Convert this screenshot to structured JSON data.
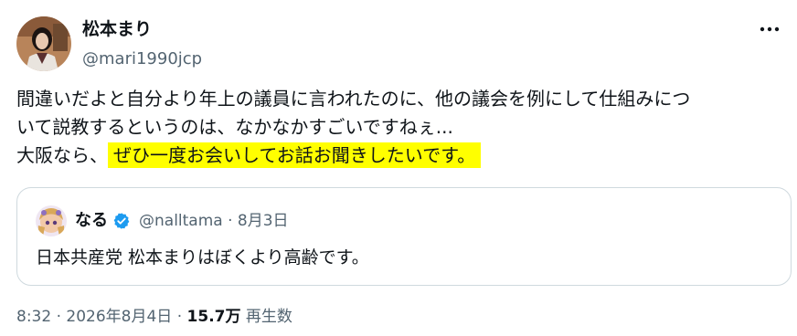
{
  "colors": {
    "highlight": "#ffff00",
    "verified_badge": "#1d9bf0",
    "secondary_text": "#536471",
    "border": "#cfd9de"
  },
  "author": {
    "display_name": "松本まり",
    "handle": "@mari1990jcp",
    "avatar_icon": "profile-photo"
  },
  "menu": {
    "icon": "more-horizontal-icon"
  },
  "tweet": {
    "line1": "間違いだよと自分より年上の議員に言われたのに、他の議会を例にして仕組みにつ",
    "line2": "いて説教するというのは、なかなかすごいですねぇ...",
    "line3_prefix": "大阪なら、",
    "line3_highlight": "ぜひ一度お会いしてお話お聞きしたいです。"
  },
  "quoted": {
    "display_name": "なる",
    "verified_icon": "verified-badge-icon",
    "handle": "@nalltama",
    "separator": "·",
    "date": "8月3日",
    "text": "日本共産党 松本まりはぼくより高齢です。"
  },
  "footer": {
    "time": "8:32",
    "sep1": "·",
    "date": "2026年8月4日",
    "sep2": "·",
    "views_count": "15.7万",
    "views_label": "再生数"
  }
}
